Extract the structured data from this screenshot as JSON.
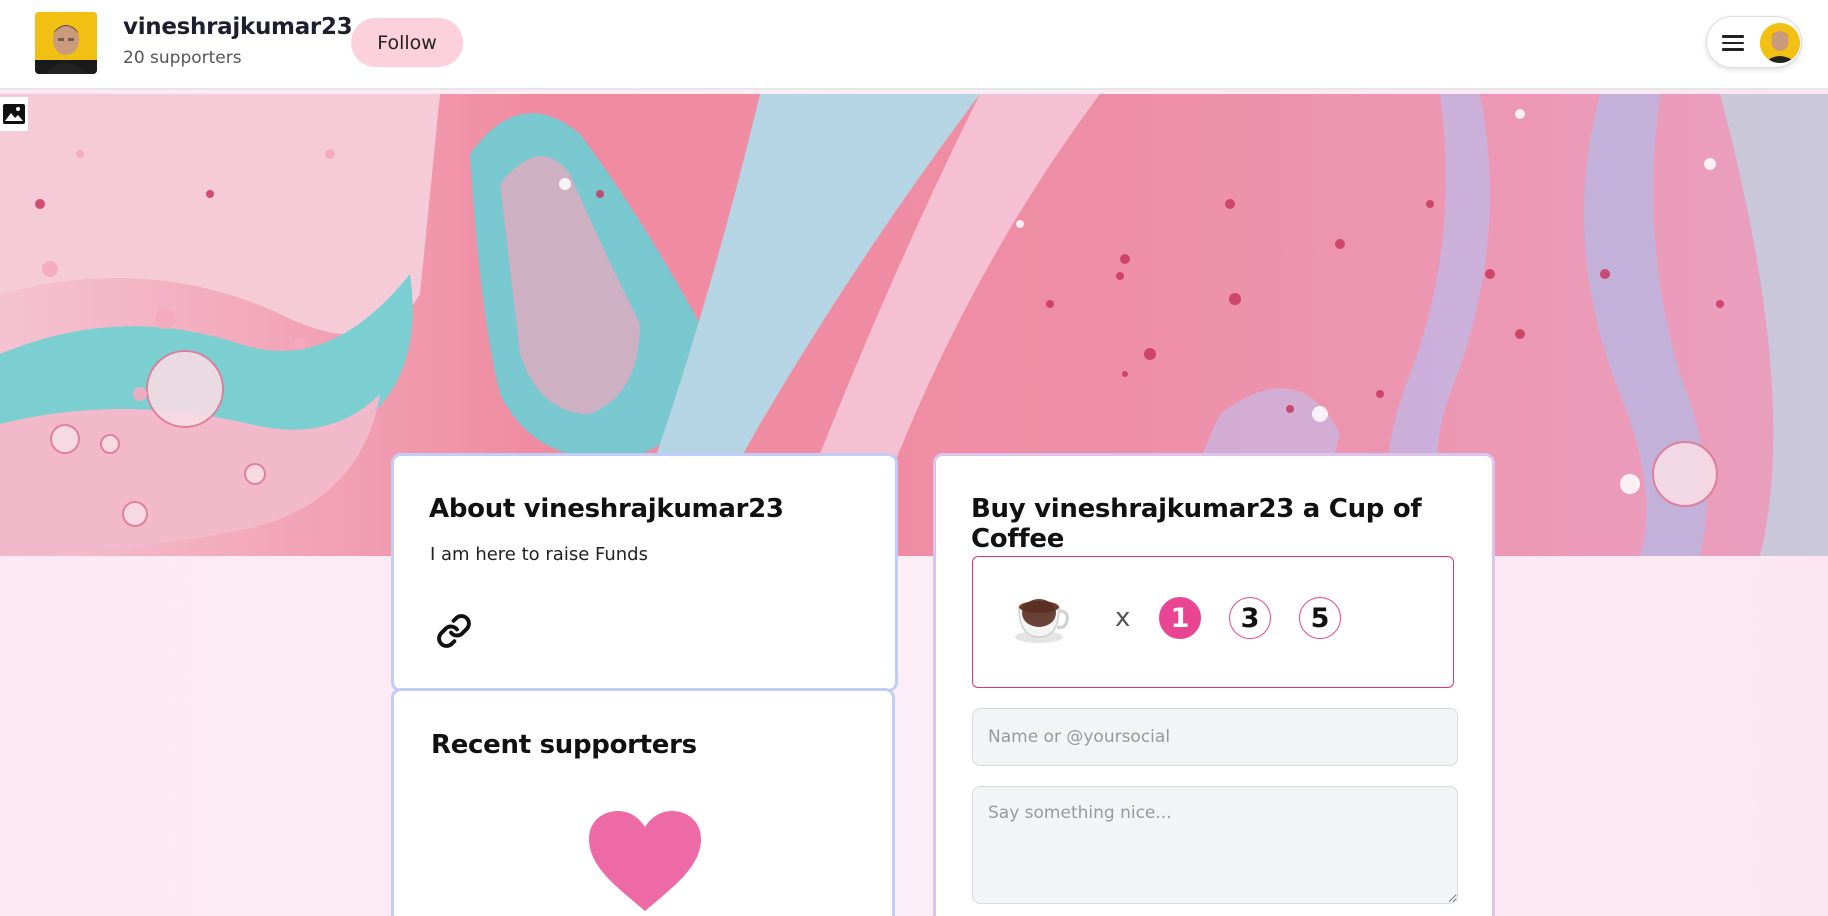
{
  "header": {
    "username": "vineshrajkumar23",
    "supporters": "20 supporters",
    "follow_label": "Follow"
  },
  "about": {
    "title": "About vineshrajkumar23",
    "text": "I am here to raise Funds"
  },
  "recent_supporters": {
    "title": "Recent supporters"
  },
  "coffee": {
    "title": "Buy vineshrajkumar23 a Cup of Coffee",
    "multiplier": "x",
    "quantities": [
      "1",
      "3",
      "5"
    ],
    "selected_quantity": "1",
    "name_placeholder": "Name or @yoursocial",
    "message_placeholder": "Say something nice..."
  },
  "icons": {
    "cover_edit": "image-icon",
    "menu": "hamburger-icon",
    "link": "link-icon",
    "heart": "heart-icon",
    "cup": "coffee-cup-icon"
  },
  "colors": {
    "accent_pink": "#e94592",
    "follow_bg": "#fdd1dc",
    "card_border": "#c2cdf6",
    "heart": "#ee6aa7"
  }
}
